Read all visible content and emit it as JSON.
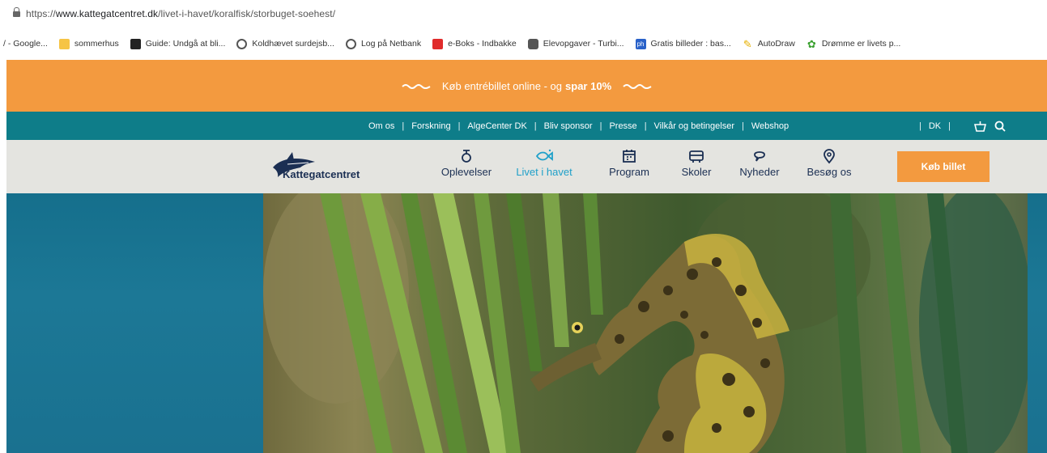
{
  "browser": {
    "url_prefix": "https://",
    "url_domain": "www.kattegatcentret.dk",
    "url_path": "/livet-i-havet/koralfisk/storbuget-soehest/"
  },
  "bookmarks": [
    {
      "label": "/ - Google...",
      "icon": "globe-icon"
    },
    {
      "label": "sommerhus",
      "icon": "folder-icon"
    },
    {
      "label": "Guide: Undgå at bli...",
      "icon": "news-icon"
    },
    {
      "label": "Koldhævet surdejsb...",
      "icon": "globe-icon"
    },
    {
      "label": "Log på Netbank",
      "icon": "globe-icon"
    },
    {
      "label": "e-Boks - Indbakke",
      "icon": "eboks-icon"
    },
    {
      "label": "Elevopgaver - Turbi...",
      "icon": "binoculars-icon"
    },
    {
      "label": "Gratis billeder : bas...",
      "icon": "pixabay-icon"
    },
    {
      "label": "AutoDraw",
      "icon": "pen-icon"
    },
    {
      "label": "Drømme er livets p...",
      "icon": "plant-icon"
    }
  ],
  "promo": {
    "text": "Køb entrébillet online - og",
    "highlight": "spar 10%",
    "color": "#f39a3f"
  },
  "utility_nav": {
    "links": [
      "Om os",
      "Forskning",
      "AlgeCenter DK",
      "Bliv sponsor",
      "Presse",
      "Vilkår og betingelser",
      "Webshop"
    ],
    "separator": "|",
    "language": "DK",
    "color": "#0e7d89"
  },
  "main_nav": {
    "logo_text": "Kattegatcentret",
    "items": [
      {
        "label": "Oplevelser",
        "icon": "experience-icon",
        "active": false
      },
      {
        "label": "Livet i havet",
        "icon": "fish-icon",
        "active": true
      },
      {
        "label": "Program",
        "icon": "calendar-icon",
        "active": false
      },
      {
        "label": "Skoler",
        "icon": "bus-icon",
        "active": false
      },
      {
        "label": "Nyheder",
        "icon": "speech-bubble-icon",
        "active": false
      },
      {
        "label": "Besøg os",
        "icon": "location-pin-icon",
        "active": false
      }
    ],
    "buy_button": "Køb billet",
    "active_color": "#1fa0c9",
    "text_color": "#1b2f53"
  },
  "hero": {
    "image": "seahorse-photo",
    "background": "#156f8c"
  }
}
